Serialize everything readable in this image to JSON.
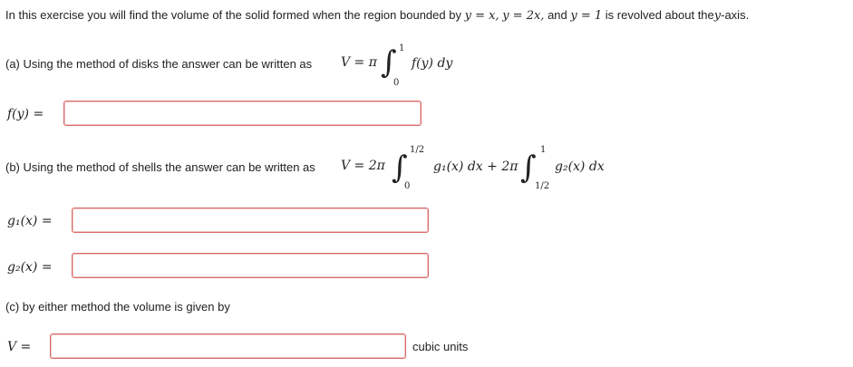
{
  "intro": {
    "text_before": "In this exercise you will find the volume of the solid formed when the region bounded by",
    "eq1": "y = x,",
    "eq2": "y = 2x,",
    "and": "and",
    "eq3": "y = 1",
    "text_after": "is revolved about the",
    "axis": "y",
    "axis_suffix": "-axis."
  },
  "part_a": {
    "text": "(a) Using the method of disks the answer can be written as",
    "lhs": "V = π",
    "upper": "1",
    "lower": "0",
    "integrand": "f(y) dy",
    "answer_label": "f(y) =",
    "answer_value": ""
  },
  "part_b": {
    "text": "(b) Using the method of shells the answer can be written as",
    "lhs": "V = 2π",
    "upper1": "1/2",
    "lower1": "0",
    "integrand1": "g₁(x) dx + 2π",
    "upper2": "1",
    "lower2": "1/2",
    "integrand2": "g₂(x) dx",
    "g1_label": "g₁(x) =",
    "g1_value": "",
    "g2_label": "g₂(x) =",
    "g2_value": ""
  },
  "part_c": {
    "text": "(c) by either method the volume is given by",
    "v_label": "V =",
    "v_value": "",
    "units": "cubic units"
  },
  "colors": {
    "box_border": "#d96a6a",
    "text": "#222222"
  }
}
